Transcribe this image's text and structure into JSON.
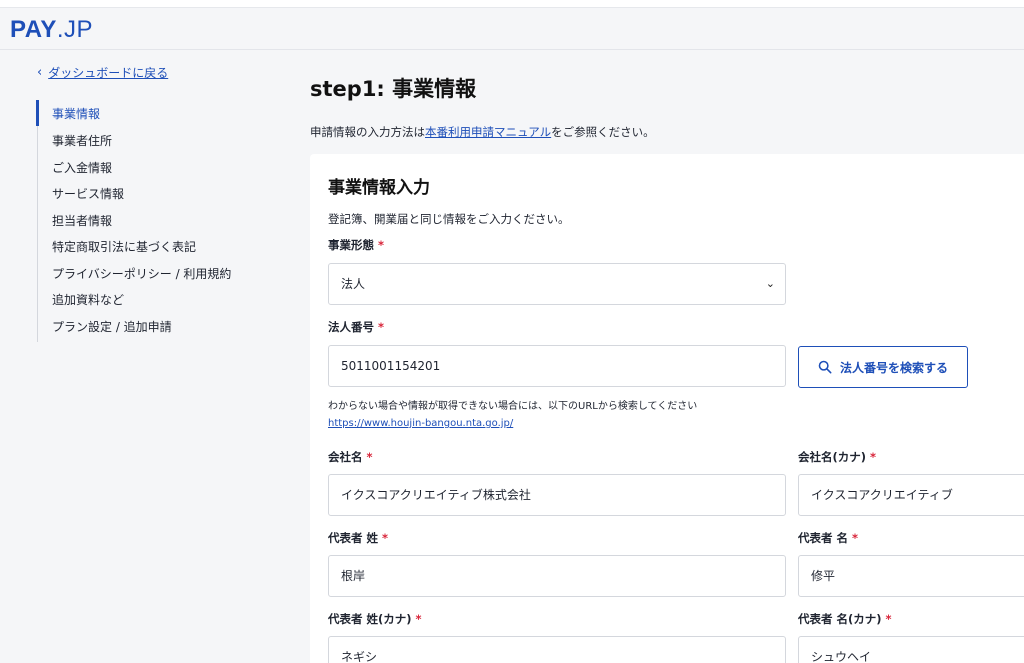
{
  "header": {
    "logo_bold": "PAY",
    "logo_light": ".JP"
  },
  "sidebar": {
    "back_label": "ダッシュボードに戻る",
    "items": [
      {
        "label": "事業情報"
      },
      {
        "label": "事業者住所"
      },
      {
        "label": "ご入金情報"
      },
      {
        "label": "サービス情報"
      },
      {
        "label": "担当者情報"
      },
      {
        "label": "特定商取引法に基づく表記"
      },
      {
        "label": "プライバシーポリシー / 利用規約"
      },
      {
        "label": "追加資料など"
      },
      {
        "label": "プラン設定 / 追加申請"
      }
    ],
    "active_index": 0
  },
  "main": {
    "title": "step1: 事業情報",
    "lead_prefix": "申請情報の入力方法は",
    "lead_link": "本番利用申請マニュアル",
    "lead_suffix": "をご参照ください。"
  },
  "form": {
    "section_title": "事業情報入力",
    "section_desc": "登記簿、開業届と同じ情報をご入力ください。",
    "required_mark": "*",
    "business_type": {
      "label": "事業形態",
      "value": "法人"
    },
    "corporate_number": {
      "label": "法人番号",
      "value": "5011001154201"
    },
    "search_button": "法人番号を検索する",
    "hint": "わからない場合や情報が取得できない場合には、以下のURLから検索してください",
    "hint_link": "https://www.houjin-bangou.nta.go.jp/",
    "company_name": {
      "label": "会社名",
      "value": "イクスコアクリエイティブ株式会社"
    },
    "company_name_kana": {
      "label": "会社名(カナ)",
      "value": "イクスコアクリエイティブ"
    },
    "rep_last": {
      "label": "代表者 姓",
      "value": "根岸"
    },
    "rep_first": {
      "label": "代表者 名",
      "value": "修平"
    },
    "rep_last_kana": {
      "label": "代表者 姓(カナ)",
      "value": "ネギシ"
    },
    "rep_first_kana": {
      "label": "代表者 名(カナ)",
      "value": "シュウヘイ"
    }
  },
  "colors": {
    "brand": "#1e4fb8",
    "required": "#d8253a"
  }
}
